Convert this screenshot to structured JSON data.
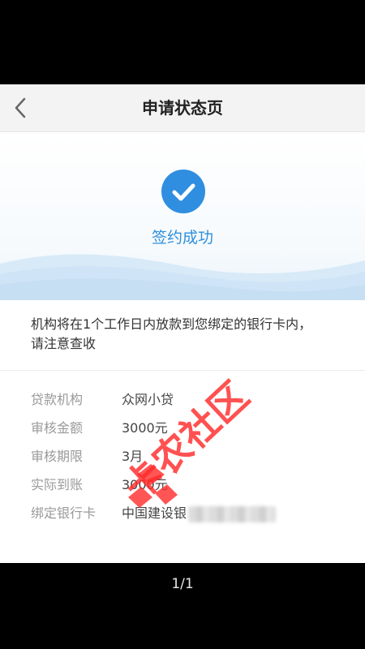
{
  "header": {
    "title": "申请状态页"
  },
  "status": {
    "text": "签约成功"
  },
  "notice": {
    "text": "机构将在1个工作日内放款到您绑定的银行卡内，请注意查收"
  },
  "details": [
    {
      "label": "贷款机构",
      "value": "众网小贷"
    },
    {
      "label": "审核金额",
      "value": "3000元"
    },
    {
      "label": "审核期限",
      "value": "3月"
    },
    {
      "label": "实际到账",
      "value": "3000元"
    },
    {
      "label": "绑定银行卡",
      "value": "中国建设银"
    }
  ],
  "watermark": {
    "text": "卡农社区"
  },
  "pager": {
    "text": "1/1"
  },
  "colors": {
    "accent": "#2f8ee0",
    "watermark": "#ff2b2b"
  },
  "icons": {
    "back": "chevron-left-icon",
    "status": "check-circle-icon"
  }
}
